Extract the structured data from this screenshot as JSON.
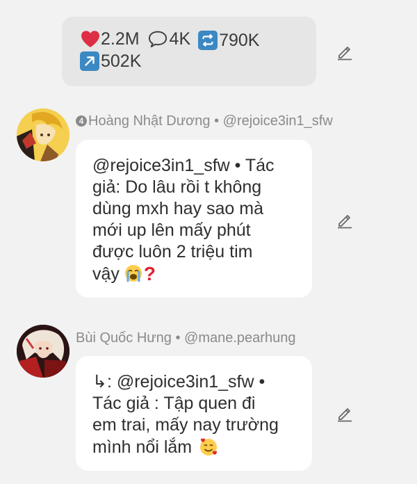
{
  "post_stats": {
    "likes": "2.2M",
    "comments": "4K",
    "reposts": "790K",
    "shares": "502K"
  },
  "comments": [
    {
      "badge": "4",
      "author": "Hoàng Nhật Dương",
      "separator": "•",
      "handle": "@rejoice3in1_sfw",
      "text_main": "@rejoice3in1_sfw • Tác\ngiả: Do lâu rồi t không\ndùng mxh hay sao mà\nmới up lên mấy phút\nđược luôn 2 triệu tim\nvậy",
      "emoji": [
        "loudly-crying-face",
        "red-question-mark"
      ]
    },
    {
      "author": "Bùi Quốc Hưng",
      "separator": "•",
      "handle": "@mane.pearhung",
      "reply_prefix": "↳",
      "text_main": ": @rejoice3in1_sfw •\nTác giả : Tập quen đi\nem trai, mấy nay trường\nmình nổi lắm",
      "emoji": [
        "smiling-face-with-hearts"
      ]
    }
  ],
  "colors": {
    "background": "#f2f2f2",
    "stats_bubble": "#e6e6e6",
    "comment_bubble": "#ffffff",
    "meta_text": "#8a8a8a",
    "heart": "#dd2e44",
    "square_icon": "#3b88c3"
  },
  "icons": [
    "heart-icon",
    "speech-bubble-icon",
    "repeat-icon",
    "arrow-up-right-icon",
    "pencil-edit-icon"
  ]
}
